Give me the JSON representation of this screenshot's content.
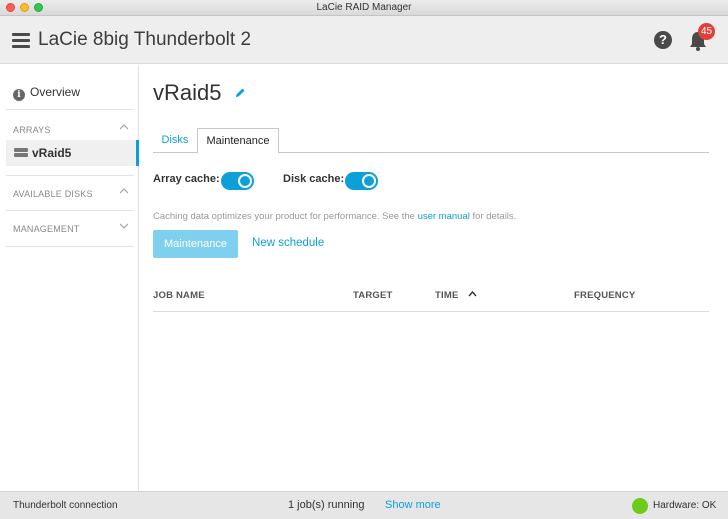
{
  "window": {
    "title": "LaCie RAID Manager"
  },
  "header": {
    "app_title": "LaCie 8big Thunderbolt 2",
    "help_glyph": "?",
    "notification_count": "45"
  },
  "sidebar": {
    "overview_label": "Overview",
    "sections": {
      "arrays": "ARRAYS",
      "available_disks": "AVAILABLE DISKS",
      "management": "MANAGEMENT"
    },
    "items": [
      {
        "label": "vRaid5",
        "selected": true
      }
    ]
  },
  "main": {
    "title": "vRaid5",
    "tabs": [
      {
        "label": "Disks"
      },
      {
        "label": "Maintenance",
        "active": true
      }
    ],
    "array_cache_label": "Array cache:",
    "array_cache_on": true,
    "disk_cache_label": "Disk cache:",
    "disk_cache_on": true,
    "caption_before": "Caching data optimizes your product for performance. See the ",
    "caption_link": "user manual",
    "caption_after": " for details.",
    "maintenance_button": "Maintenance",
    "new_schedule_link": "New schedule",
    "table_headers": [
      "JOB NAME",
      "TARGET",
      "TIME",
      "FREQUENCY"
    ]
  },
  "footer": {
    "connection": "Thunderbolt connection",
    "jobs": "1 job(s) running",
    "show_more": "Show more",
    "hardware": "Hardware: OK"
  },
  "colors": {
    "accent": "#0d9fd8",
    "status_ok": "#6fcb1a",
    "badge": "#e0403a"
  },
  "icons": [
    "menu-icon",
    "help-icon",
    "bell-icon",
    "info-icon",
    "chevron-up-icon",
    "chevron-down-icon",
    "disk-icon",
    "pencil-icon",
    "sort-up-icon",
    "status-dot-icon"
  ]
}
